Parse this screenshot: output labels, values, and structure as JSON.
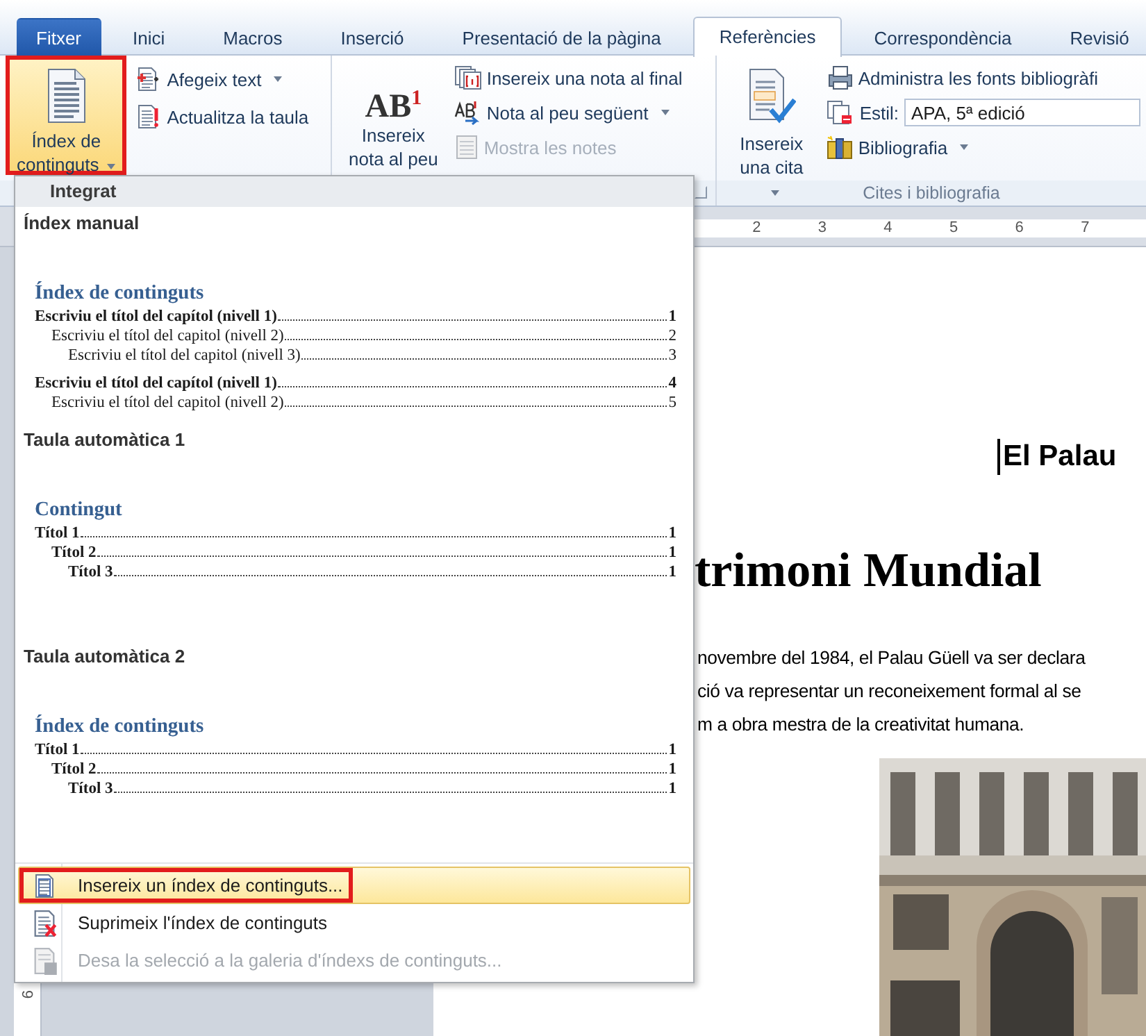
{
  "tabs": [
    {
      "label": "Fitxer",
      "kind": "file",
      "selected": false
    },
    {
      "label": "Inici",
      "kind": "tab",
      "selected": false
    },
    {
      "label": "Macros",
      "kind": "tab",
      "selected": false
    },
    {
      "label": "Inserció",
      "kind": "tab",
      "selected": false
    },
    {
      "label": "Presentació de la pàgina",
      "kind": "tab",
      "selected": false
    },
    {
      "label": "Referències",
      "kind": "tab",
      "selected": true
    },
    {
      "label": "Correspondència",
      "kind": "tab",
      "selected": false
    },
    {
      "label": "Revisió",
      "kind": "tab",
      "selected": false
    }
  ],
  "ribbon": {
    "groups": [
      {
        "large": {
          "label": "Índex de\ncontinguts",
          "dropdown": true,
          "pressed": true,
          "highlighted": true
        },
        "launcher": false,
        "small": [
          {
            "kind": "button",
            "label": "Afegeix text",
            "dropdown": true,
            "disabled": false
          },
          {
            "kind": "button",
            "label": "Actualitza la taula",
            "dropdown": false,
            "disabled": false
          }
        ]
      },
      {
        "large": {
          "label": "Insereix\nnota al peu",
          "icon_text": "AB$^{1}$",
          "dropdown": false,
          "pressed": false,
          "highlighted": false
        },
        "launcher": true,
        "small": [
          {
            "kind": "button",
            "label": "Insereix una nota al final",
            "dropdown": false,
            "disabled": false
          },
          {
            "kind": "button",
            "label": "Nota al peu següent",
            "dropdown": true,
            "disabled": false
          },
          {
            "kind": "button",
            "label": "Mostra les notes",
            "dropdown": false,
            "disabled": true
          }
        ]
      },
      {
        "large": {
          "label": "Insereix\nuna cita",
          "dropdown": true,
          "pressed": false,
          "highlighted": false
        },
        "launcher": false,
        "label": "Cites i bibliografia",
        "small": [
          {
            "kind": "button",
            "label": "Administra les fonts bibliogràfi",
            "dropdown": false,
            "disabled": false
          },
          {
            "kind": "combo",
            "label": "Estil:",
            "value": "APA, 5ª edició",
            "disabled": false
          },
          {
            "kind": "button",
            "label": "Bibliografia",
            "dropdown": true,
            "disabled": false
          }
        ]
      }
    ]
  },
  "document": {
    "ruler": [
      "2",
      "3",
      "4",
      "5",
      "6",
      "7"
    ],
    "vertical_ruler": [
      "9"
    ],
    "heading": "El Palau",
    "title": "trimoni Mundial",
    "paragraph_lines": [
      "novembre del 1984, el Palau Güell va ser declara",
      "ció va representar un reconeixement formal al se",
      "m a obra mestra de la creativitat humana."
    ],
    "photo": {
      "kind": "picture"
    }
  },
  "menu": {
    "header": "Integrat",
    "gallery": [
      {
        "name": "Índex manual",
        "preview": {
          "title": "Índex de continguts",
          "entries": [
            {
              "text": "Escriviu el títol del capítol (nivell 1)",
              "page": "1",
              "bold": true,
              "children": [
                {
                  "text": "Escriviu el títol del capitol (nivell 2)",
                  "page": "2",
                  "bold": false,
                  "children": [
                    {
                      "text": "Escriviu el títol del capitol (nivell 3)",
                      "page": "3",
                      "bold": false
                    }
                  ]
                }
              ]
            },
            {
              "text": "Escriviu el títol del capítol (nivell 1)",
              "page": "4",
              "bold": true,
              "children": [
                {
                  "text": "Escriviu el títol del capitol (nivell 2)",
                  "page": "5",
                  "bold": false
                }
              ]
            }
          ]
        }
      },
      {
        "name": "Taula automàtica 1",
        "preview": {
          "title": "Contingut",
          "entries": [
            {
              "text": "Títol 1",
              "page": "1",
              "bold": true,
              "children": [
                {
                  "text": "Títol 2",
                  "page": "1",
                  "bold": true,
                  "children": [
                    {
                      "text": "Títol 3",
                      "page": "1",
                      "bold": true
                    }
                  ]
                }
              ]
            }
          ]
        }
      },
      {
        "name": "Taula automàtica 2",
        "preview": {
          "title": "Índex de continguts",
          "entries": [
            {
              "text": "Títol 1",
              "page": "1",
              "bold": true,
              "children": [
                {
                  "text": "Títol 2",
                  "page": "1",
                  "bold": true,
                  "children": [
                    {
                      "text": "Títol 3",
                      "page": "1",
                      "bold": true
                    }
                  ]
                }
              ]
            }
          ]
        }
      }
    ],
    "items": [
      {
        "kind": "insert",
        "label": "Insereix un índex de continguts...",
        "selected": true,
        "disabled": false,
        "highlighted": true
      },
      {
        "kind": "remove",
        "label": "Suprimeix l'índex de continguts",
        "selected": false,
        "disabled": false,
        "highlighted": false
      },
      {
        "kind": "save",
        "label": "Desa la selecció a la galeria d'índexs de continguts...",
        "selected": false,
        "disabled": true,
        "highlighted": false
      }
    ]
  }
}
